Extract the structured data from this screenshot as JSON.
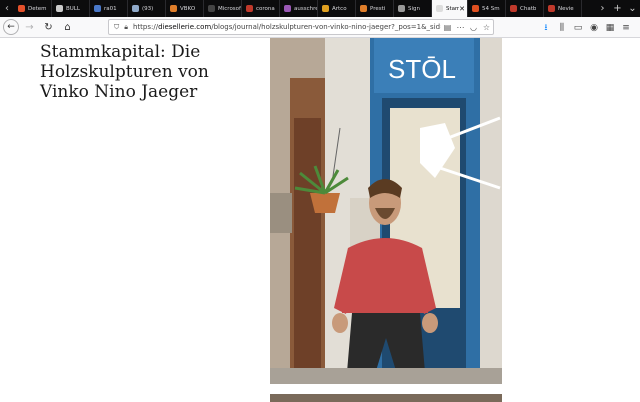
{
  "browser": {
    "tabs": [
      {
        "label": "Detem",
        "color": "#e5512b"
      },
      {
        "label": "BULL",
        "color": "#cccccc"
      },
      {
        "label": "ra01",
        "color": "#4a78c8"
      },
      {
        "label": "(93)",
        "color": "#8fa9c9"
      },
      {
        "label": "VBKÖ",
        "color": "#e07e2a"
      },
      {
        "label": "Microsof",
        "color": "#444444"
      },
      {
        "label": "corona",
        "color": "#c0392b"
      },
      {
        "label": "ausschreib",
        "color": "#9b59b6"
      },
      {
        "label": "Artco",
        "color": "#e0a020"
      },
      {
        "label": "Presti",
        "color": "#e07e2a"
      },
      {
        "label": "Sign",
        "color": "#999999"
      },
      {
        "label": "Stamm",
        "color": "#dddddd",
        "active": true
      },
      {
        "label": "54 Sm",
        "color": "#e05020"
      },
      {
        "label": "Chatb",
        "color": "#c0392b"
      },
      {
        "label": "Nevie",
        "color": "#c0392b"
      }
    ],
    "url": {
      "prefix": "https://",
      "domain": "diesellerie.com",
      "path": "/blogs/journal/holzskulpturen-von-vinko-nino-jaeger?_pos=1&_sid=b"
    }
  },
  "article": {
    "title": "Stammkapital: Die Holzskulpturen von Vinko Nino Jaeger",
    "shop_sign": "STŌL"
  }
}
